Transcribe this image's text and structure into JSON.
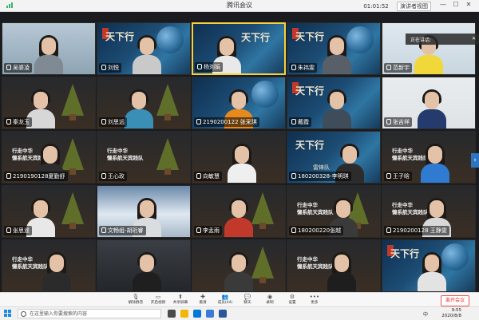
{
  "window": {
    "title": "腾讯会议",
    "timer": "01:01:52",
    "gallery_view_label": "演讲者视图",
    "minimize": "—",
    "maximize": "☐",
    "close": "✕"
  },
  "speaking_popup": {
    "label": "正在讲话:",
    "close": "✕"
  },
  "participants": [
    {
      "name": "吴婆凌"
    },
    {
      "name": "刘悦"
    },
    {
      "name": "杨刘娟"
    },
    {
      "name": "朱祎雯"
    },
    {
      "name": "范新宇"
    },
    {
      "name": "秦龙玉"
    },
    {
      "name": "刘思远"
    },
    {
      "name": "2190200122 张采琪"
    },
    {
      "name": "戴霞"
    },
    {
      "name": "张吉祥"
    },
    {
      "name": "2190190128夏勤舒"
    },
    {
      "name": "王心玫"
    },
    {
      "name": "向敏慧"
    },
    {
      "name": "180200328-李明琪"
    },
    {
      "name": "王子晗"
    },
    {
      "name": "张思遥"
    },
    {
      "name": "文畅组-胡珩睿"
    },
    {
      "name": "李孟雨"
    },
    {
      "name": "180200220张越"
    },
    {
      "name": "2190200128 王静雯"
    },
    {
      "name": ""
    },
    {
      "name": ""
    },
    {
      "name": ""
    },
    {
      "name": ""
    },
    {
      "name": ""
    }
  ],
  "tile_texts": {
    "calligraphy": "天下行",
    "calligraphy_sub": "雷锋队",
    "banner_line1": "行走中华",
    "banner_line2": "懒系航天宾践队"
  },
  "toolbar": {
    "items": [
      {
        "label": "解除静音",
        "icon": "mic-icon"
      },
      {
        "label": "开启视频",
        "icon": "video-icon"
      },
      {
        "label": "共享屏幕",
        "icon": "share-screen-icon"
      },
      {
        "label": "邀请",
        "icon": "invite-icon"
      },
      {
        "label": "成员(44)",
        "icon": "members-icon"
      },
      {
        "label": "聊天",
        "icon": "chat-icon"
      },
      {
        "label": "录制",
        "icon": "record-icon"
      },
      {
        "label": "设置",
        "icon": "settings-icon"
      },
      {
        "label": "更多",
        "icon": "more-icon"
      }
    ],
    "end_meeting": "离开会议"
  },
  "taskbar": {
    "search_placeholder": "在这里输入你要搜索的内容",
    "time": "9:55",
    "date": "2020/8/8",
    "ime": "中"
  },
  "colors": {
    "active_speaker_border": "#f5d23a",
    "accent_blue": "#2f74c0",
    "end_red": "#e33333"
  }
}
